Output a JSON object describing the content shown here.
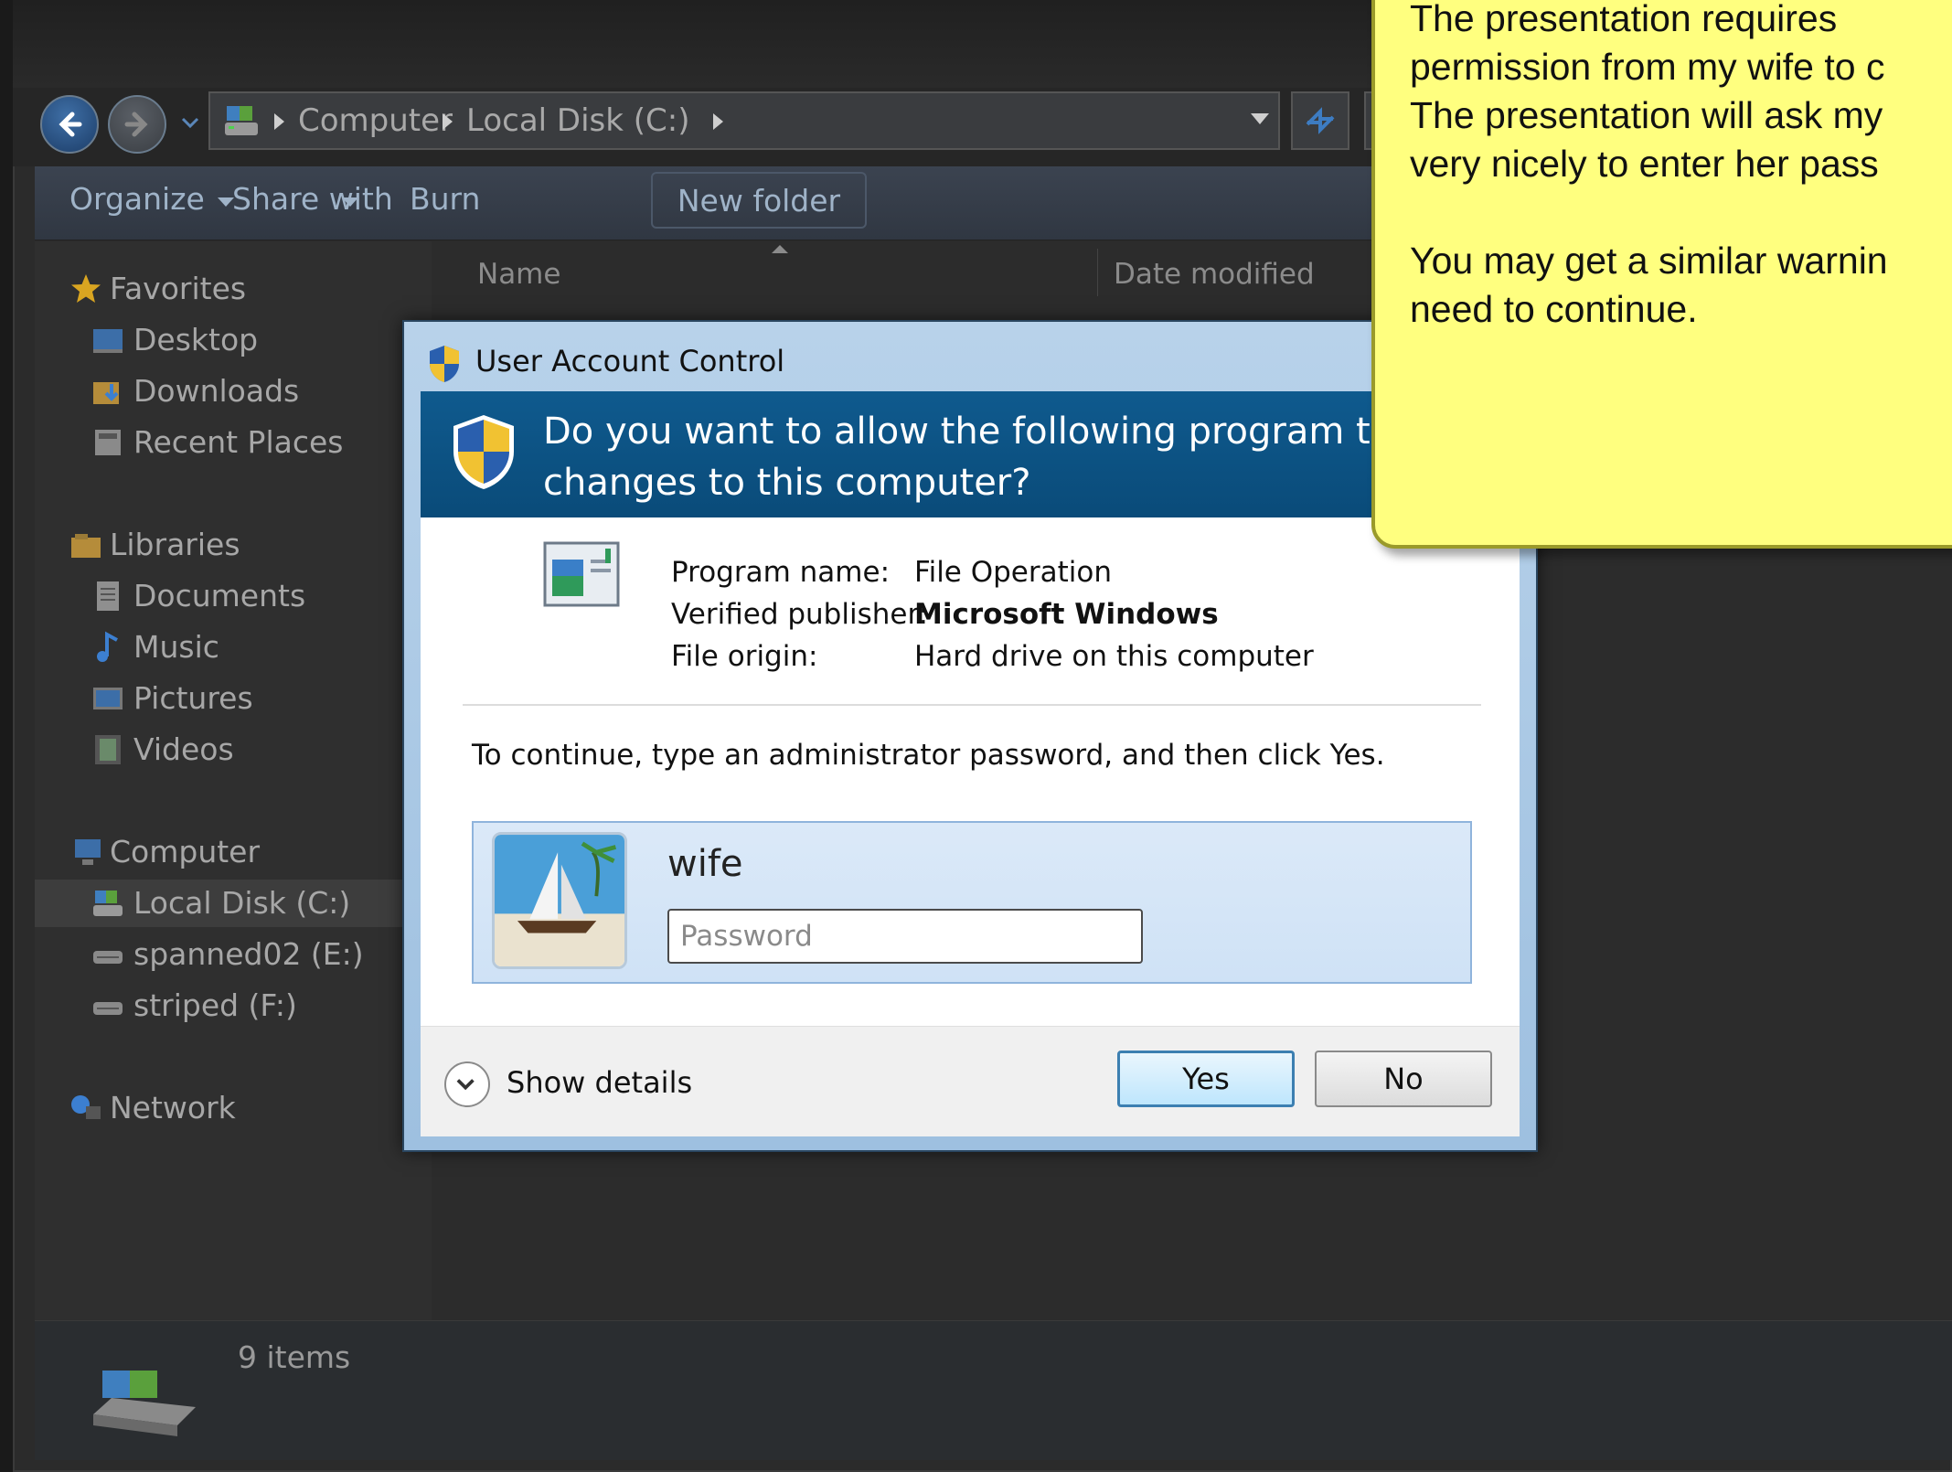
{
  "explorer": {
    "breadcrumbs": [
      "Computer",
      "Local Disk (C:)"
    ],
    "toolbar": {
      "organize": "Organize",
      "share_with": "Share with",
      "burn": "Burn",
      "new_folder": "New folder"
    },
    "columns": {
      "name": "Name",
      "date_modified": "Date modified"
    },
    "nav": {
      "favorites": "Favorites",
      "desktop": "Desktop",
      "downloads": "Downloads",
      "recent_places": "Recent Places",
      "libraries": "Libraries",
      "documents": "Documents",
      "music": "Music",
      "pictures": "Pictures",
      "videos": "Videos",
      "computer": "Computer",
      "local_disk": "Local Disk (C:)",
      "spanned": "spanned02 (E:)",
      "striped": "striped (F:)",
      "network": "Network"
    },
    "status": {
      "item_count": "9 items"
    }
  },
  "uac": {
    "title": "User Account Control",
    "question": "Do you want to allow the following program to m changes to this computer?",
    "program_name_label": "Program name:",
    "program_name": "File Operation",
    "publisher_label": "Verified publisher:",
    "publisher": "Microsoft Windows",
    "origin_label": "File origin:",
    "origin": "Hard drive on this computer",
    "instruction": "To continue, type an administrator password, and then click Yes.",
    "user_name": "wife",
    "password_placeholder": "Password",
    "show_details": "Show details",
    "yes": "Yes",
    "no": "No"
  },
  "callout": {
    "text": "The presentation requires\npermission from my wife to c\nThe presentation will ask my\nvery nicely to enter her pass\n\nYou may get a similar warnin\nneed to continue."
  },
  "colors": {
    "uac_banner": "#0a4b79",
    "callout_bg": "#ffff7f",
    "yes_button_border": "#3c7fb1"
  }
}
